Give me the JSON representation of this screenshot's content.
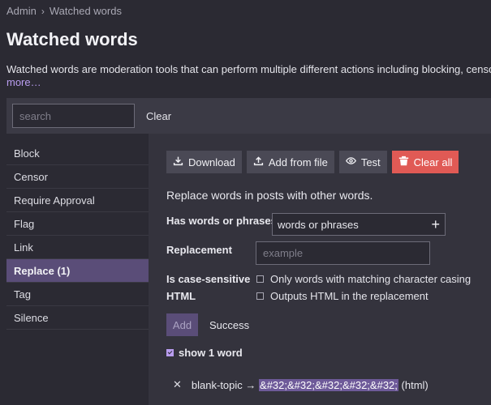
{
  "breadcrumb": {
    "parent": "Admin",
    "separator": "›",
    "current": "Watched words"
  },
  "page": {
    "title": "Watched words",
    "description": "Watched words are moderation tools that can perform multiple different actions including blocking, censoring",
    "more_link": "more…"
  },
  "search": {
    "placeholder": "search",
    "clear_label": "Clear"
  },
  "sidebar": {
    "items": [
      {
        "label": "Block"
      },
      {
        "label": "Censor"
      },
      {
        "label": "Require Approval"
      },
      {
        "label": "Flag"
      },
      {
        "label": "Link"
      },
      {
        "label": "Replace (1)",
        "active": true
      },
      {
        "label": "Tag"
      },
      {
        "label": "Silence"
      }
    ]
  },
  "toolbar": {
    "download": "Download",
    "add_from_file": "Add from file",
    "test": "Test",
    "clear_all": "Clear all"
  },
  "form": {
    "description": "Replace words in posts with other words.",
    "words_label": "Has words or phrases",
    "words_value": "words or phrases",
    "replacement_label": "Replacement",
    "replacement_placeholder": "example",
    "case_label": "Is case-sensitive",
    "case_text": "Only words with matching character casing",
    "html_label": "HTML",
    "html_text": "Outputs HTML in the replacement",
    "add_button": "Add",
    "status": "Success"
  },
  "word_list": {
    "show_label": "show 1 word",
    "items": [
      {
        "word": "blank-topic",
        "arrow": "→",
        "replacement": "&#32;&#32;&#32;&#32;&#32;",
        "suffix": "(html)"
      }
    ]
  },
  "colors": {
    "background": "#2b2a33",
    "panel": "#34333d",
    "accent": "#5a4d78",
    "link": "#b99df0",
    "danger": "#e05a55"
  }
}
